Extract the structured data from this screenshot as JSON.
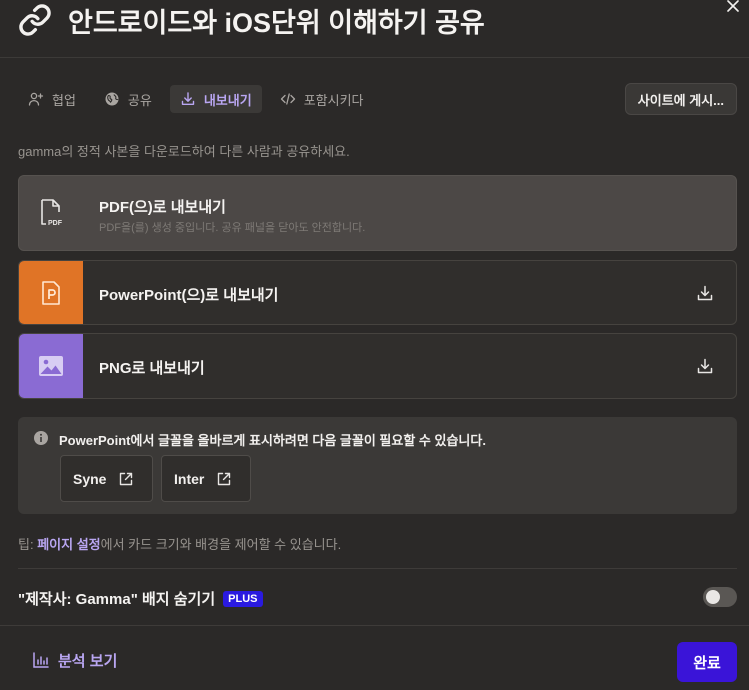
{
  "header": {
    "title": "안드로이드와 iOS단위 이해하기 공유",
    "title_icon": "link-icon",
    "close_icon": "close-icon"
  },
  "tabs": [
    {
      "label": "협업",
      "icon": "add-user-icon",
      "active": false
    },
    {
      "label": "공유",
      "icon": "globe-icon",
      "active": false
    },
    {
      "label": "내보내기",
      "icon": "download-icon",
      "active": true
    },
    {
      "label": "포함시키다",
      "icon": "code-icon",
      "active": false
    }
  ],
  "publish_button": "사이트에 게시...",
  "description": "gamma의 정적 사본을 다운로드하여 다른 사람과 공유하세요.",
  "exports": {
    "pdf": {
      "title": "PDF(으)로 내보내기",
      "subtitle": "PDF을(를) 생성 중입니다. 공유 패널을 닫아도 안전합니다.",
      "icon": "pdf-file-icon"
    },
    "ppt": {
      "title": "PowerPoint(으)로 내보내기",
      "icon": "powerpoint-icon",
      "accent": "#e07426"
    },
    "png": {
      "title": "PNG로 내보내기",
      "icon": "image-icon",
      "accent": "#8a6bd3"
    }
  },
  "font_notice": {
    "text": "PowerPoint에서 글꼴을 올바르게 표시하려면 다음 글꼴이 필요할 수 있습니다.",
    "fonts": [
      "Syne",
      "Inter"
    ]
  },
  "tip": {
    "prefix": "팁:",
    "link": "페이지 설정",
    "suffix": "에서 카드 크기와 배경을 제어할 수 있습니다."
  },
  "badge": {
    "label": "\"제작사: Gamma\" 배지 숨기기",
    "plan": "PLUS",
    "enabled": false
  },
  "footer": {
    "analytics": "분석 보기",
    "done": "완료"
  },
  "colors": {
    "accent_purple": "#b9a6f2",
    "done_button": "#3a14d8",
    "plus_badge": "#2a1ae0"
  }
}
